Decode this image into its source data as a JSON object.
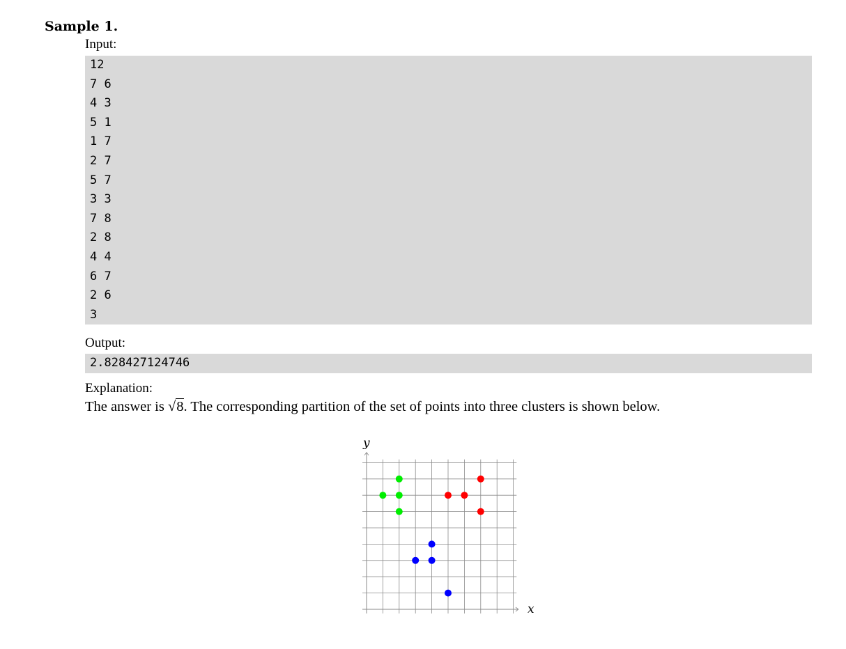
{
  "sample_title": "Sample 1.",
  "input_label": "Input:",
  "input_lines": [
    "12",
    "7 6",
    "4 3",
    "5 1",
    "1 7",
    "2 7",
    "5 7",
    "3 3",
    "7 8",
    "2 8",
    "4 4",
    "6 7",
    "2 6",
    "3"
  ],
  "output_label": "Output:",
  "output_lines": [
    "2.828427124746"
  ],
  "explanation_label": "Explanation:",
  "explanation": {
    "before": "The answer is ",
    "sqrt_symbol": "√",
    "radicand": "8",
    "after": ". The corresponding partition of the set of points into three clusters is shown below."
  },
  "chart_data": {
    "type": "scatter",
    "xlabel": "x",
    "ylabel": "y",
    "xlim": [
      0,
      9
    ],
    "ylim": [
      0,
      9
    ],
    "grid": true,
    "series": [
      {
        "color": "#00ee00",
        "points": [
          [
            1,
            7
          ],
          [
            2,
            7
          ],
          [
            2,
            6
          ],
          [
            2,
            8
          ]
        ]
      },
      {
        "color": "#ff0000",
        "points": [
          [
            5,
            7
          ],
          [
            6,
            7
          ],
          [
            7,
            8
          ],
          [
            7,
            6
          ]
        ]
      },
      {
        "color": "#0000ff",
        "points": [
          [
            4,
            3
          ],
          [
            3,
            3
          ],
          [
            4,
            4
          ],
          [
            5,
            1
          ]
        ]
      }
    ]
  }
}
